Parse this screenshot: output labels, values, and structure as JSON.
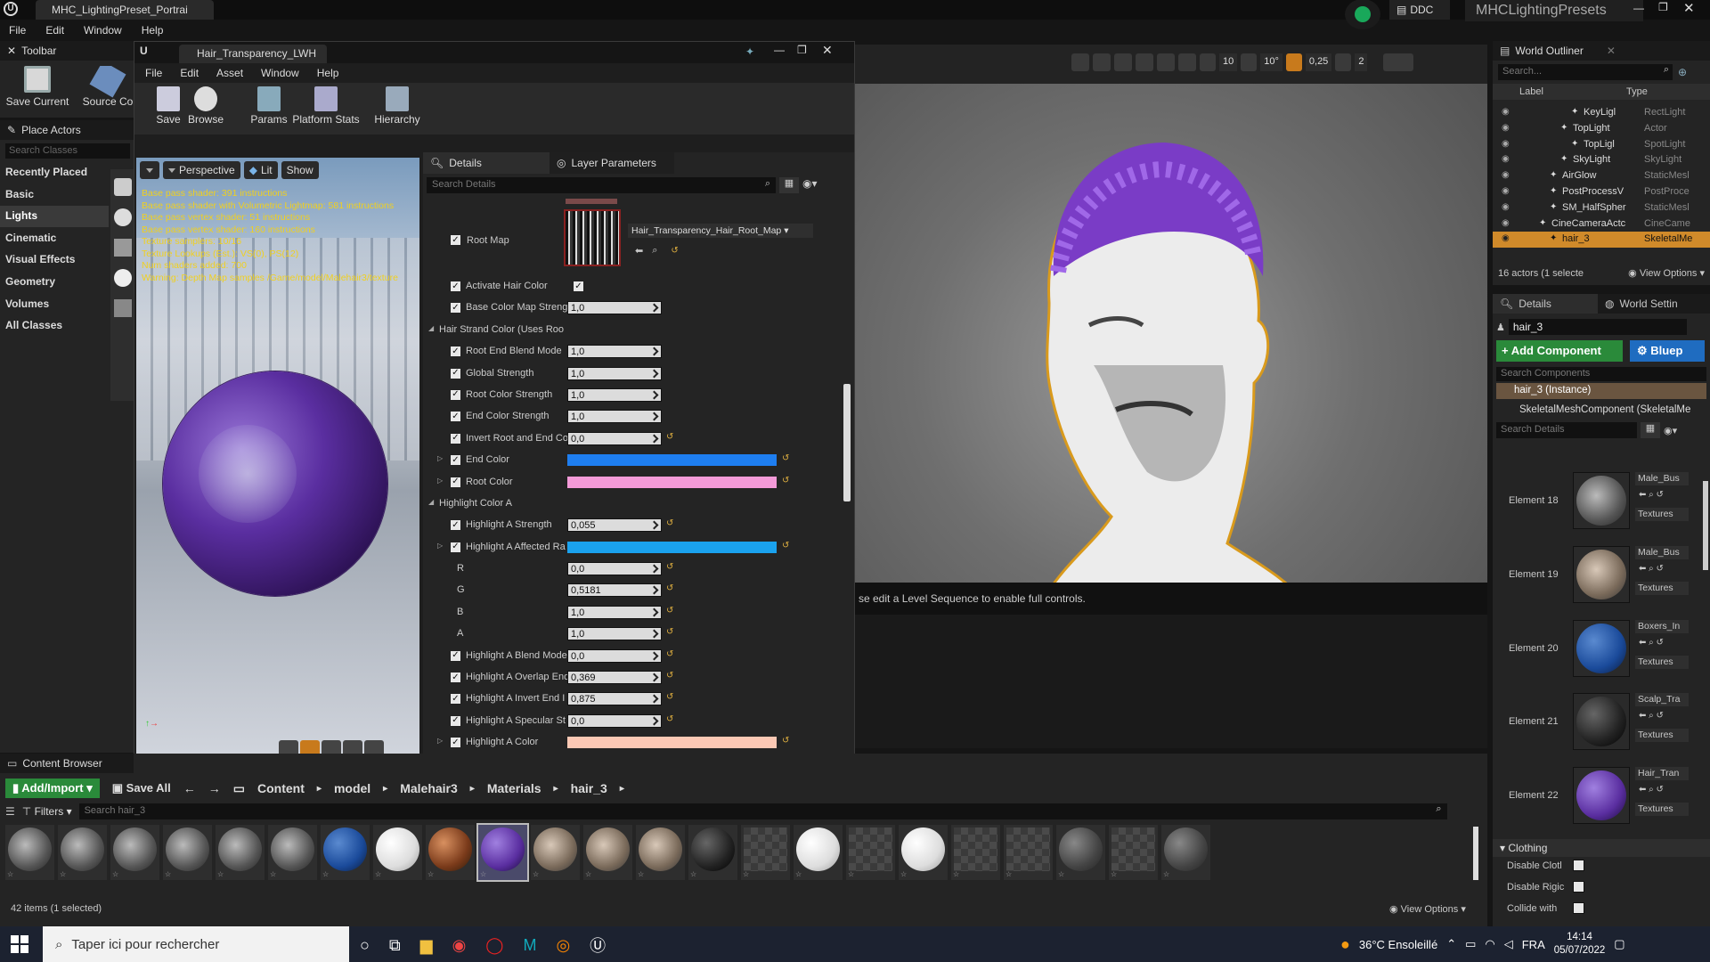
{
  "title_bar": {
    "project_tab": "MHC_LightingPreset_Portrai",
    "ddc_label": "DDC",
    "project_name": "MHCLightingPresets"
  },
  "main_menu": [
    "File",
    "Edit",
    "Window",
    "Help"
  ],
  "toolbar": {
    "title": "Toolbar",
    "save_current": "Save Current",
    "source_control": "Source Co"
  },
  "place_actors": {
    "title": "Place Actors",
    "search_placeholder": "Search Classes",
    "categories": [
      "Recently Placed",
      "Basic",
      "Lights",
      "Cinematic",
      "Visual Effects",
      "Geometry",
      "Volumes",
      "All Classes"
    ],
    "selected": "Lights"
  },
  "material_editor": {
    "tab_title": "Hair_Transparency_LWH",
    "menu": [
      "File",
      "Edit",
      "Asset",
      "Window",
      "Help"
    ],
    "toolbar": [
      "Save",
      "Browse",
      "Params",
      "Platform Stats",
      "Hierarchy"
    ],
    "viewport": {
      "perspective": "Perspective",
      "lit": "Lit",
      "show": "Show",
      "stats": [
        "Base pass shader: 391 instructions",
        "Base pass shader with Volumetric Lightmap: 581 instructions",
        "Base pass vertex shader: 51 instructions",
        "Base pass vertex shader: 160 instructions",
        "Texture samplers: 10/16",
        "Texture Lookups (Est.): VS(0), PS(12)",
        "Num shaders added: 700",
        "Warning: Depth Map samples /Game/model/Malehair3/texture"
      ]
    },
    "details": {
      "tab_details": "Details",
      "tab_layers": "Layer Parameters",
      "search_placeholder": "Search Details",
      "root_map_label": "Root Map",
      "root_map_asset": "Hair_Transparency_Hair_Root_Map",
      "rows": [
        {
          "label": "Activate Hair Color",
          "type": "check",
          "value": ""
        },
        {
          "label": "Base Color Map Streng",
          "type": "num",
          "value": "1,0"
        },
        {
          "label": "Hair Strand Color (Uses Roo",
          "type": "group",
          "value": ""
        },
        {
          "label": "Root End Blend Mode",
          "type": "num",
          "value": "1,0"
        },
        {
          "label": "Global Strength",
          "type": "num",
          "value": "1,0"
        },
        {
          "label": "Root Color Strength",
          "type": "num",
          "value": "1,0"
        },
        {
          "label": "End Color Strength",
          "type": "num",
          "value": "1,0"
        },
        {
          "label": "Invert Root and End Col",
          "type": "num",
          "value": "0,0"
        },
        {
          "label": "End Color",
          "type": "color",
          "value": "#1e7ef0"
        },
        {
          "label": "Root Color",
          "type": "color",
          "value": "#f49ad8"
        },
        {
          "label": "Highlight Color A",
          "type": "group",
          "value": ""
        },
        {
          "label": "Highlight A Strength",
          "type": "num",
          "value": "0,055"
        },
        {
          "label": "Highlight A Affected Ra",
          "type": "color",
          "value": "#1aa2ee"
        },
        {
          "label": "R",
          "type": "sub",
          "value": "0,0"
        },
        {
          "label": "G",
          "type": "sub",
          "value": "0,5181"
        },
        {
          "label": "B",
          "type": "sub",
          "value": "1,0"
        },
        {
          "label": "A",
          "type": "sub",
          "value": "1,0"
        },
        {
          "label": "Highlight A Blend Mode",
          "type": "num",
          "value": "0,0"
        },
        {
          "label": "Highlight A Overlap End",
          "type": "num",
          "value": "0,369"
        },
        {
          "label": "Highlight A Invert End I",
          "type": "num",
          "value": "0,875"
        },
        {
          "label": "Highlight A Specular St",
          "type": "num",
          "value": "0,0"
        },
        {
          "label": "Highlight A Color",
          "type": "color",
          "value": "#fcc8b4"
        }
      ]
    }
  },
  "level_viewport": {
    "toolbar_values": [
      "10",
      "10°",
      "0,25",
      "2"
    ],
    "sequencer_msg": "se edit a Level Sequence to enable full controls."
  },
  "world_outliner": {
    "title": "World Outliner",
    "search_placeholder": "Search...",
    "col_label": "Label",
    "col_type": "Type",
    "rows": [
      {
        "label": "KeyLigl",
        "type": "RectLight",
        "indent": 3,
        "selected": false
      },
      {
        "label": "TopLight",
        "type": "Actor",
        "indent": 2,
        "selected": false
      },
      {
        "label": "TopLigl",
        "type": "SpotLight",
        "indent": 3,
        "selected": false
      },
      {
        "label": "SkyLight",
        "type": "SkyLight",
        "indent": 2,
        "selected": false
      },
      {
        "label": "AirGlow",
        "type": "StaticMesl",
        "indent": 1,
        "selected": false
      },
      {
        "label": "PostProcessV",
        "type": "PostProce",
        "indent": 1,
        "selected": false
      },
      {
        "label": "SM_HalfSpher",
        "type": "StaticMesl",
        "indent": 1,
        "selected": false
      },
      {
        "label": "CineCameraActc",
        "type": "CineCame",
        "indent": 0,
        "selected": false
      },
      {
        "label": "hair_3",
        "type": "SkeletalMe",
        "indent": 1,
        "selected": true
      }
    ],
    "footer": "16 actors (1 selecte",
    "view_options": "View Options"
  },
  "details_panel": {
    "tab": "Details",
    "tab2": "World Settin",
    "name_value": "hair_3",
    "add_component": "+ Add Component",
    "blueprint": "Bluep",
    "search_components": "Search Components",
    "instance": "hair_3 (Instance)",
    "component": "SkeletalMeshComponent (SkeletalMe",
    "search_details": "Search Details",
    "elements": [
      {
        "label": "Element 18",
        "asset": "Male_Bus",
        "btn": "Textures",
        "style": "strands"
      },
      {
        "label": "Element 19",
        "asset": "Male_Bus",
        "btn": "Textures",
        "style": "strands2"
      },
      {
        "label": "Element 20",
        "asset": "Boxers_In",
        "btn": "Textures",
        "style": "blue"
      },
      {
        "label": "Element 21",
        "asset": "Scalp_Tra",
        "btn": "Textures",
        "style": "dark"
      },
      {
        "label": "Element 22",
        "asset": "Hair_Tran",
        "btn": "Textures",
        "style": "purple"
      }
    ],
    "clothing": "Clothing",
    "clothing_rows": [
      "Disable Clotl",
      "Disable Rigic",
      "Collide with"
    ]
  },
  "content_browser": {
    "title": "Content Browser",
    "add_import": "Add/Import",
    "save_all": "Save All",
    "breadcrumb": [
      "Content",
      "model",
      "Malehair3",
      "Materials",
      "hair_3"
    ],
    "filters": "Filters",
    "search_placeholder": "Search hair_3",
    "footer": "42 items (1 selected)",
    "view_options": "View Options",
    "assets": [
      "strands",
      "strands",
      "strands",
      "strands",
      "strands",
      "strands",
      "blue",
      "white",
      "brown",
      "purple",
      "strands2",
      "strands2",
      "strands2",
      "dark",
      "checker",
      "white",
      "checker",
      "white",
      "checker",
      "checker",
      "darkgrey",
      "checker",
      "darkgrey"
    ]
  },
  "taskbar": {
    "search_placeholder": "Taper ici pour rechercher",
    "weather": "36°C Ensoleillé",
    "lang": "FRA",
    "time": "14:14",
    "date": "05/07/2022"
  }
}
